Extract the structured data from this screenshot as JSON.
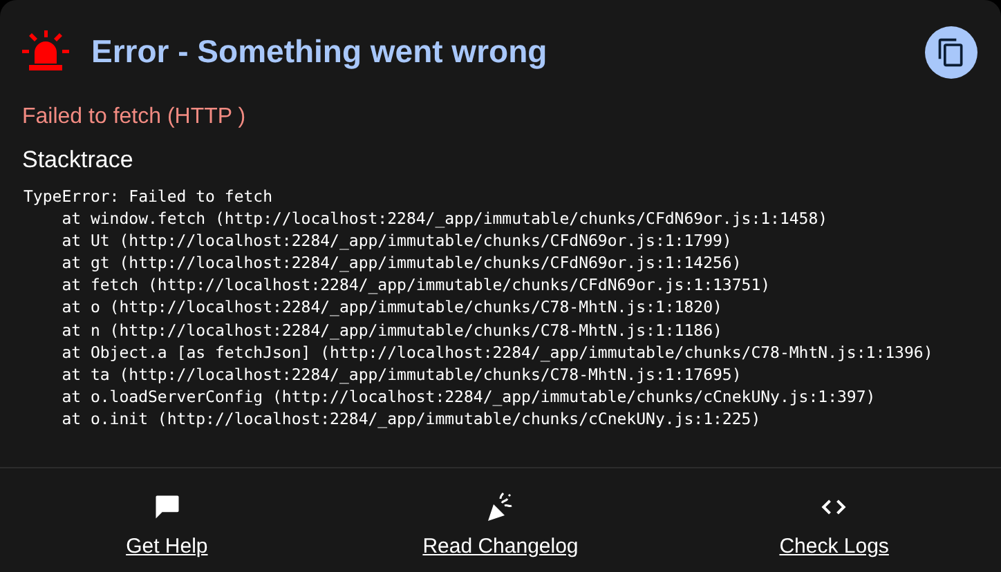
{
  "header": {
    "title": "Error - Something went wrong"
  },
  "message": "Failed to fetch (HTTP )",
  "stacktrace": {
    "heading": "Stacktrace",
    "lines": [
      "TypeError: Failed to fetch",
      "    at window.fetch (http://localhost:2284/_app/immutable/chunks/CFdN69or.js:1:1458)",
      "    at Ut (http://localhost:2284/_app/immutable/chunks/CFdN69or.js:1:1799)",
      "    at gt (http://localhost:2284/_app/immutable/chunks/CFdN69or.js:1:14256)",
      "    at fetch (http://localhost:2284/_app/immutable/chunks/CFdN69or.js:1:13751)",
      "    at o (http://localhost:2284/_app/immutable/chunks/C78-MhtN.js:1:1820)",
      "    at n (http://localhost:2284/_app/immutable/chunks/C78-MhtN.js:1:1186)",
      "    at Object.a [as fetchJson] (http://localhost:2284/_app/immutable/chunks/C78-MhtN.js:1:1396)",
      "    at ta (http://localhost:2284/_app/immutable/chunks/C78-MhtN.js:1:17695)",
      "    at o.loadServerConfig (http://localhost:2284/_app/immutable/chunks/cCnekUNy.js:1:397)",
      "    at o.init (http://localhost:2284/_app/immutable/chunks/cCnekUNy.js:1:225)"
    ]
  },
  "actions": [
    {
      "kind": "help",
      "label": "Get Help"
    },
    {
      "kind": "changelog",
      "label": "Read Changelog"
    },
    {
      "kind": "logs",
      "label": "Check Logs"
    }
  ]
}
